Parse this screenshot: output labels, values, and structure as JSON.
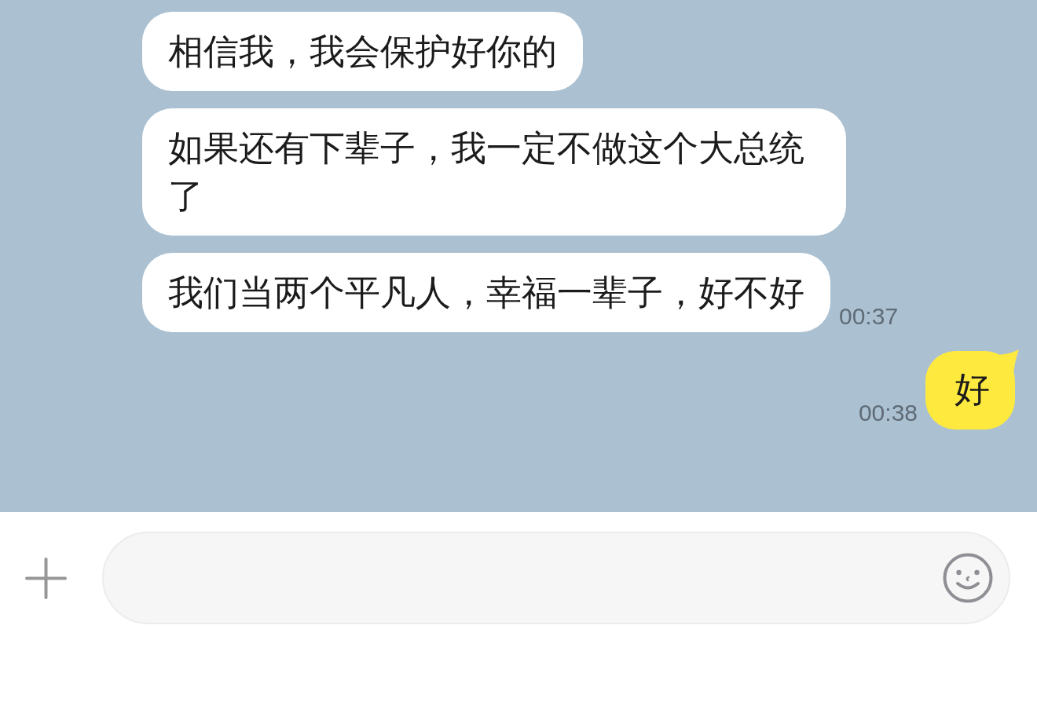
{
  "messages": [
    {
      "kind": "received",
      "text": "相信我，我会保护好你的"
    },
    {
      "kind": "received",
      "text": "如果还有下辈子，我一定不做这个大总统了"
    },
    {
      "kind": "received",
      "text": "我们当两个平凡人，幸福一辈子，好不好",
      "time": "00:37"
    },
    {
      "kind": "sent",
      "text": "好",
      "time": "00:38"
    }
  ]
}
